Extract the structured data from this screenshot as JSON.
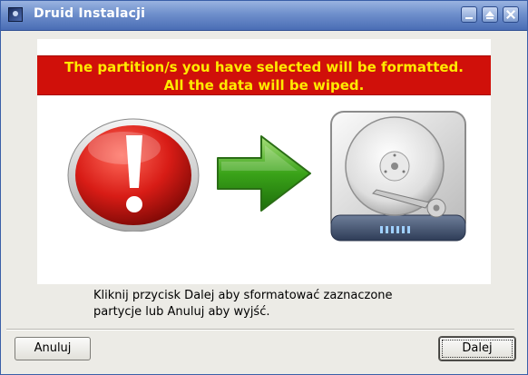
{
  "window": {
    "title": "Druid Instalacji",
    "controls": {
      "minimize_icon": "minimize-icon",
      "maximize_icon": "maximize-icon",
      "close_icon": "close-icon"
    }
  },
  "illustration": {
    "banner_line1": "The partition/s you have selected will be formatted.",
    "banner_line2": "All the data will be wiped.",
    "icons": [
      "warning-icon",
      "arrow-right-icon",
      "hard-drive-icon"
    ],
    "colors": {
      "banner_bg": "#d0100a",
      "banner_text": "#ffea00",
      "warning_red": "#d81c16",
      "arrow_green": "#3aa319"
    }
  },
  "message": {
    "line1": "Kliknij przycisk Dalej aby sformatować zaznaczone",
    "line2": "partycje lub Anuluj aby wyjść."
  },
  "buttons": {
    "cancel_label": "Anuluj",
    "next_label": "Dalej"
  }
}
